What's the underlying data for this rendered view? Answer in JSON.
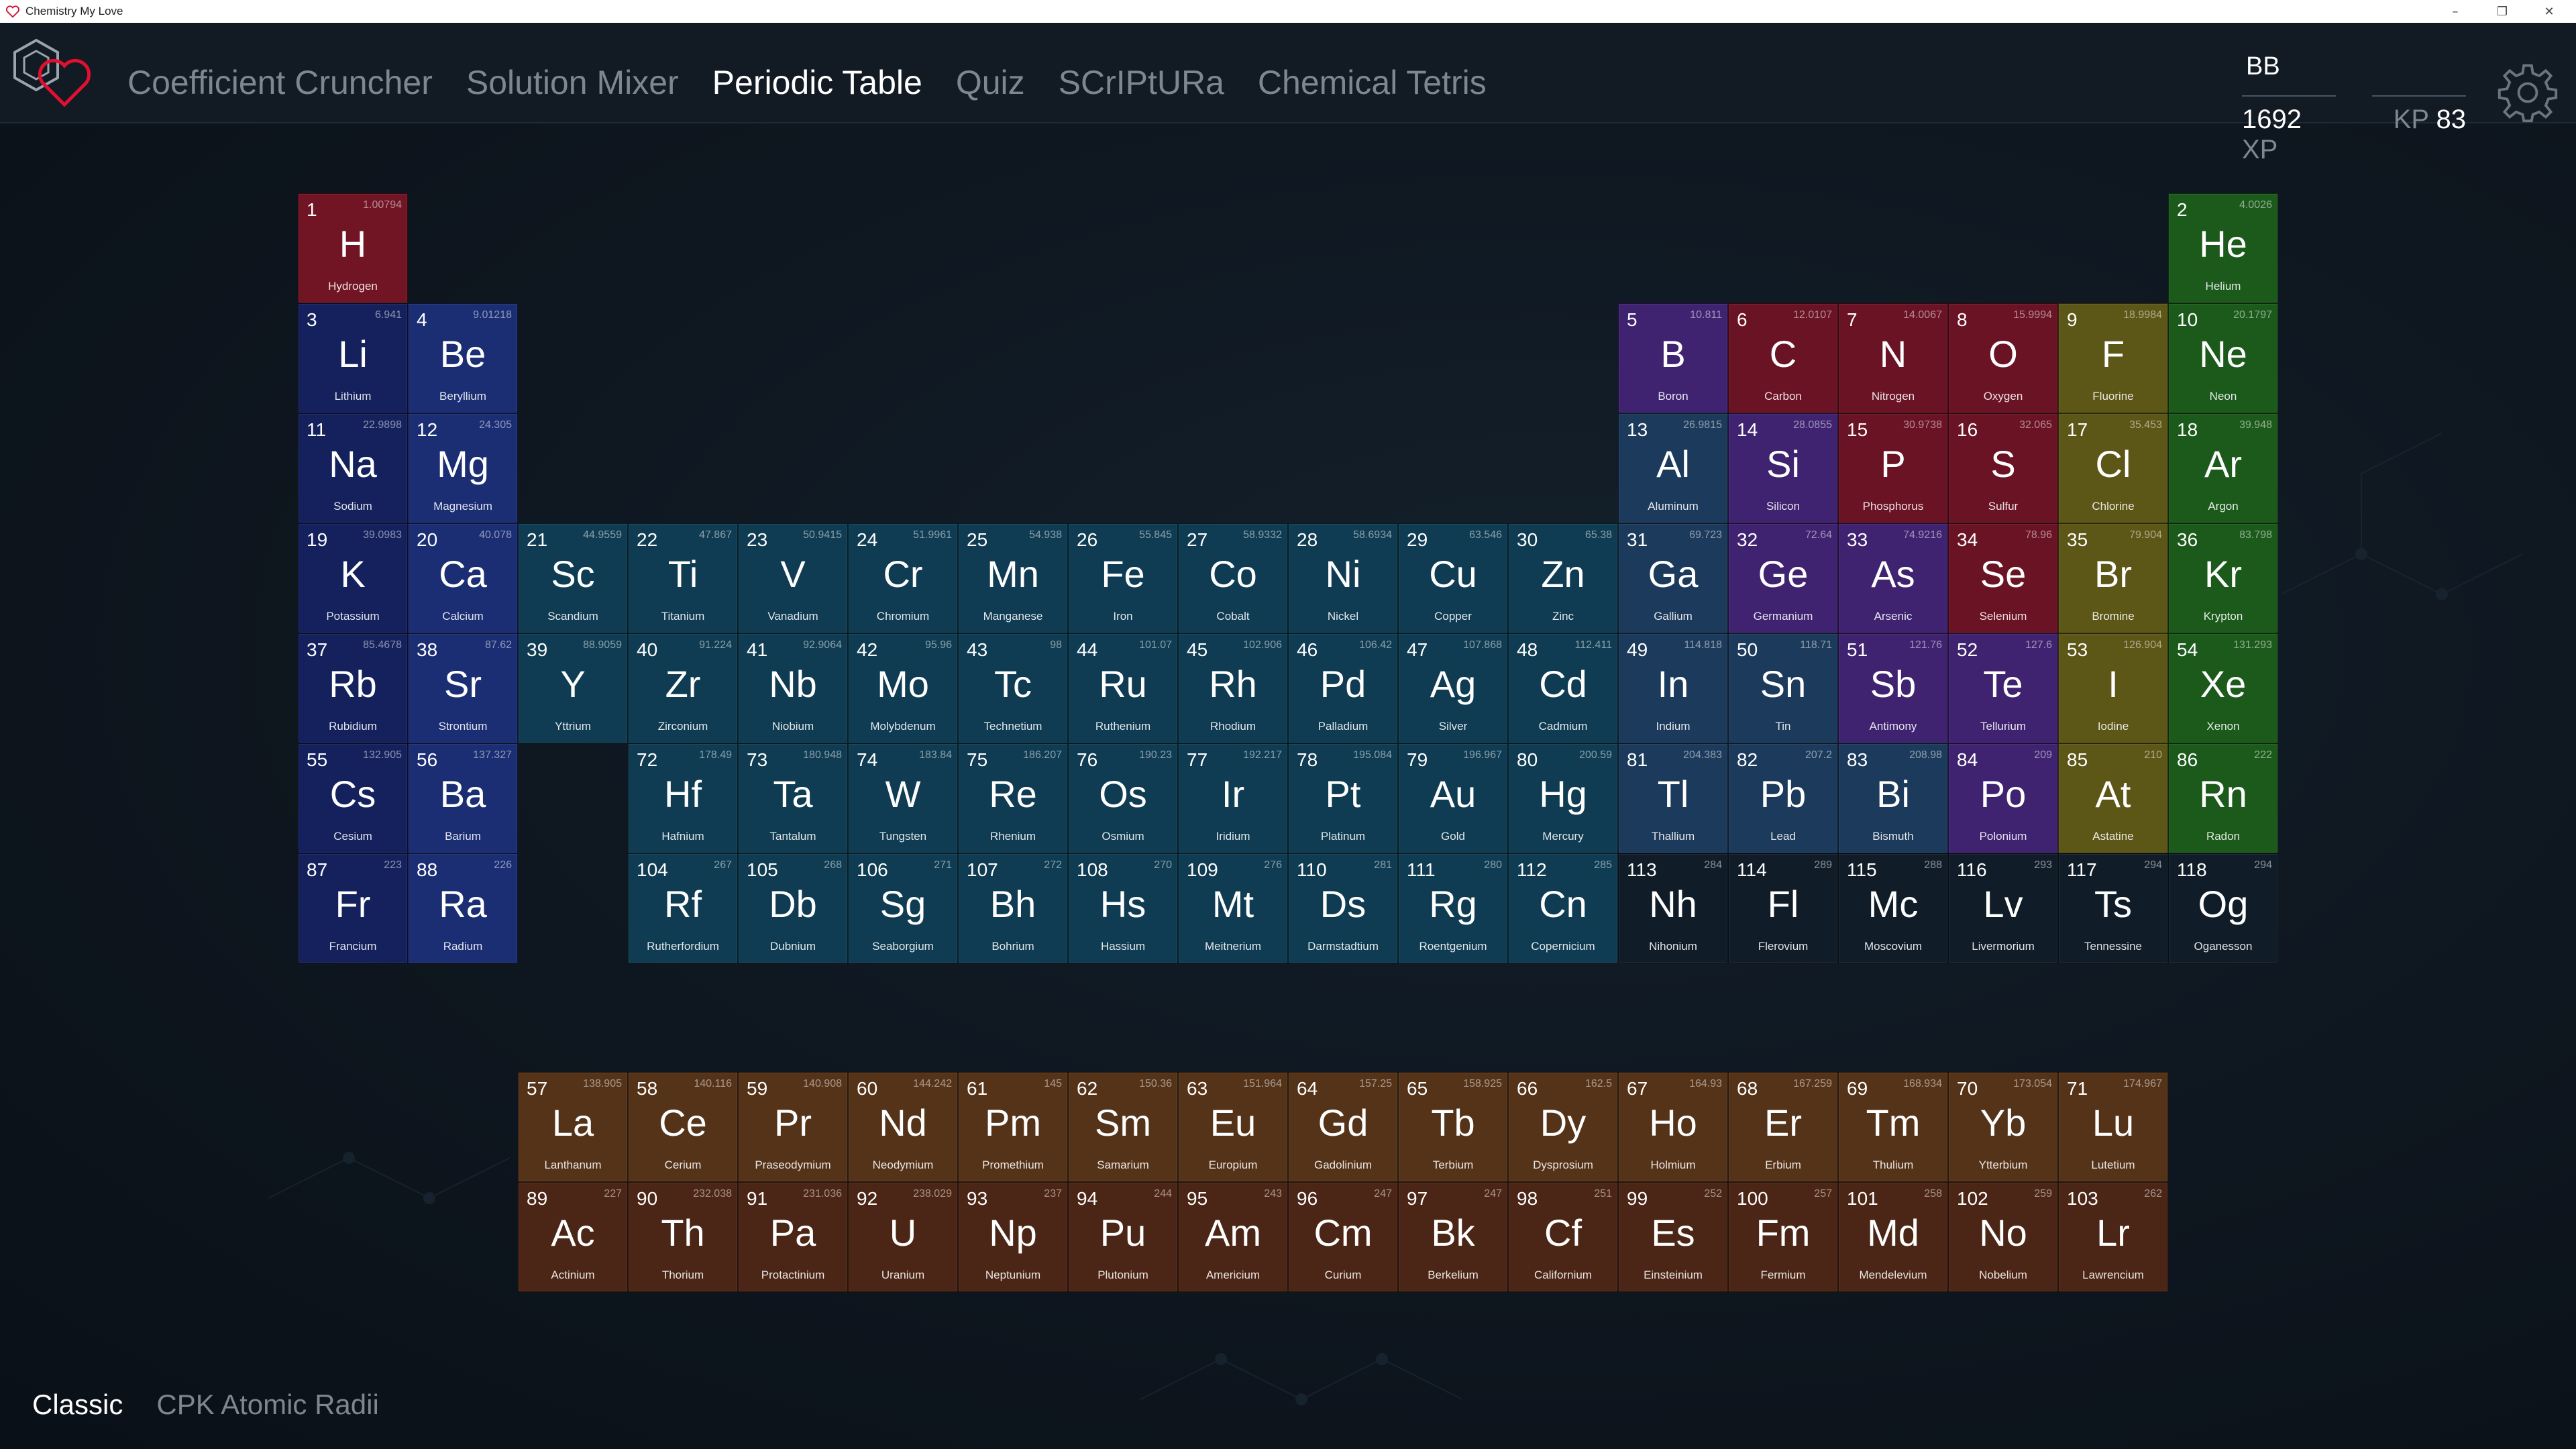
{
  "window": {
    "title": "Chemistry My Love",
    "minimize": "–",
    "maximize": "❐",
    "close": "✕"
  },
  "nav": [
    "Coefficient Cruncher",
    "Solution Mixer",
    "Periodic Table",
    "Quiz",
    "SCrIPtURa",
    "Chemical Tetris"
  ],
  "nav_active": "Periodic Table",
  "user": {
    "name": "BB",
    "xp_value": "1692",
    "xp_label": "XP",
    "kp_label": "KP",
    "kp_value": "83"
  },
  "modes": [
    "Classic",
    "CPK Atomic Radii"
  ],
  "mode_active": "Classic",
  "icons": {
    "settings": "gear-icon",
    "logo": "heart-hexagon-logo"
  },
  "colors": {
    "nonmetal": "#711524",
    "alkali": "#14215c",
    "alkaline": "#1b2e73",
    "transition": "#0f3c52",
    "posttransition": "#1c3a5b",
    "metalloid": "#3f2370",
    "reactive": "#6a1324",
    "halogen": "#5c5617",
    "noble": "#1c5a1c",
    "unknown": "#101d29",
    "lanthanide": "#543319",
    "actinide": "#4b2515"
  },
  "elements": [
    [
      "1",
      "H",
      "Hydrogen",
      "1.00794",
      1,
      1,
      "nonmetal"
    ],
    [
      "2",
      "He",
      "Helium",
      "4.0026",
      18,
      1,
      "noble"
    ],
    [
      "3",
      "Li",
      "Lithium",
      "6.941",
      1,
      2,
      "alkali"
    ],
    [
      "4",
      "Be",
      "Beryllium",
      "9.01218",
      2,
      2,
      "alkaline"
    ],
    [
      "5",
      "B",
      "Boron",
      "10.811",
      13,
      2,
      "metalloid"
    ],
    [
      "6",
      "C",
      "Carbon",
      "12.0107",
      14,
      2,
      "reactive"
    ],
    [
      "7",
      "N",
      "Nitrogen",
      "14.0067",
      15,
      2,
      "reactive"
    ],
    [
      "8",
      "O",
      "Oxygen",
      "15.9994",
      16,
      2,
      "reactive"
    ],
    [
      "9",
      "F",
      "Fluorine",
      "18.9984",
      17,
      2,
      "halogen"
    ],
    [
      "10",
      "Ne",
      "Neon",
      "20.1797",
      18,
      2,
      "noble"
    ],
    [
      "11",
      "Na",
      "Sodium",
      "22.9898",
      1,
      3,
      "alkali"
    ],
    [
      "12",
      "Mg",
      "Magnesium",
      "24.305",
      2,
      3,
      "alkaline"
    ],
    [
      "13",
      "Al",
      "Aluminum",
      "26.9815",
      13,
      3,
      "posttransition"
    ],
    [
      "14",
      "Si",
      "Silicon",
      "28.0855",
      14,
      3,
      "metalloid"
    ],
    [
      "15",
      "P",
      "Phosphorus",
      "30.9738",
      15,
      3,
      "reactive"
    ],
    [
      "16",
      "S",
      "Sulfur",
      "32.065",
      16,
      3,
      "reactive"
    ],
    [
      "17",
      "Cl",
      "Chlorine",
      "35.453",
      17,
      3,
      "halogen"
    ],
    [
      "18",
      "Ar",
      "Argon",
      "39.948",
      18,
      3,
      "noble"
    ],
    [
      "19",
      "K",
      "Potassium",
      "39.0983",
      1,
      4,
      "alkali"
    ],
    [
      "20",
      "Ca",
      "Calcium",
      "40.078",
      2,
      4,
      "alkaline"
    ],
    [
      "21",
      "Sc",
      "Scandium",
      "44.9559",
      3,
      4,
      "transition"
    ],
    [
      "22",
      "Ti",
      "Titanium",
      "47.867",
      4,
      4,
      "transition"
    ],
    [
      "23",
      "V",
      "Vanadium",
      "50.9415",
      5,
      4,
      "transition"
    ],
    [
      "24",
      "Cr",
      "Chromium",
      "51.9961",
      6,
      4,
      "transition"
    ],
    [
      "25",
      "Mn",
      "Manganese",
      "54.938",
      7,
      4,
      "transition"
    ],
    [
      "26",
      "Fe",
      "Iron",
      "55.845",
      8,
      4,
      "transition"
    ],
    [
      "27",
      "Co",
      "Cobalt",
      "58.9332",
      9,
      4,
      "transition"
    ],
    [
      "28",
      "Ni",
      "Nickel",
      "58.6934",
      10,
      4,
      "transition"
    ],
    [
      "29",
      "Cu",
      "Copper",
      "63.546",
      11,
      4,
      "transition"
    ],
    [
      "30",
      "Zn",
      "Zinc",
      "65.38",
      12,
      4,
      "transition"
    ],
    [
      "31",
      "Ga",
      "Gallium",
      "69.723",
      13,
      4,
      "posttransition"
    ],
    [
      "32",
      "Ge",
      "Germanium",
      "72.64",
      14,
      4,
      "metalloid"
    ],
    [
      "33",
      "As",
      "Arsenic",
      "74.9216",
      15,
      4,
      "metalloid"
    ],
    [
      "34",
      "Se",
      "Selenium",
      "78.96",
      16,
      4,
      "reactive"
    ],
    [
      "35",
      "Br",
      "Bromine",
      "79.904",
      17,
      4,
      "halogen"
    ],
    [
      "36",
      "Kr",
      "Krypton",
      "83.798",
      18,
      4,
      "noble"
    ],
    [
      "37",
      "Rb",
      "Rubidium",
      "85.4678",
      1,
      5,
      "alkali"
    ],
    [
      "38",
      "Sr",
      "Strontium",
      "87.62",
      2,
      5,
      "alkaline"
    ],
    [
      "39",
      "Y",
      "Yttrium",
      "88.9059",
      3,
      5,
      "transition"
    ],
    [
      "40",
      "Zr",
      "Zirconium",
      "91.224",
      4,
      5,
      "transition"
    ],
    [
      "41",
      "Nb",
      "Niobium",
      "92.9064",
      5,
      5,
      "transition"
    ],
    [
      "42",
      "Mo",
      "Molybdenum",
      "95.96",
      6,
      5,
      "transition"
    ],
    [
      "43",
      "Tc",
      "Technetium",
      "98",
      7,
      5,
      "transition"
    ],
    [
      "44",
      "Ru",
      "Ruthenium",
      "101.07",
      8,
      5,
      "transition"
    ],
    [
      "45",
      "Rh",
      "Rhodium",
      "102.906",
      9,
      5,
      "transition"
    ],
    [
      "46",
      "Pd",
      "Palladium",
      "106.42",
      10,
      5,
      "transition"
    ],
    [
      "47",
      "Ag",
      "Silver",
      "107.868",
      11,
      5,
      "transition"
    ],
    [
      "48",
      "Cd",
      "Cadmium",
      "112.411",
      12,
      5,
      "transition"
    ],
    [
      "49",
      "In",
      "Indium",
      "114.818",
      13,
      5,
      "posttransition"
    ],
    [
      "50",
      "Sn",
      "Tin",
      "118.71",
      14,
      5,
      "posttransition"
    ],
    [
      "51",
      "Sb",
      "Antimony",
      "121.76",
      15,
      5,
      "metalloid"
    ],
    [
      "52",
      "Te",
      "Tellurium",
      "127.6",
      16,
      5,
      "metalloid"
    ],
    [
      "53",
      "I",
      "Iodine",
      "126.904",
      17,
      5,
      "halogen"
    ],
    [
      "54",
      "Xe",
      "Xenon",
      "131.293",
      18,
      5,
      "noble"
    ],
    [
      "55",
      "Cs",
      "Cesium",
      "132.905",
      1,
      6,
      "alkali"
    ],
    [
      "56",
      "Ba",
      "Barium",
      "137.327",
      2,
      6,
      "alkaline"
    ],
    [
      "72",
      "Hf",
      "Hafnium",
      "178.49",
      4,
      6,
      "transition"
    ],
    [
      "73",
      "Ta",
      "Tantalum",
      "180.948",
      5,
      6,
      "transition"
    ],
    [
      "74",
      "W",
      "Tungsten",
      "183.84",
      6,
      6,
      "transition"
    ],
    [
      "75",
      "Re",
      "Rhenium",
      "186.207",
      7,
      6,
      "transition"
    ],
    [
      "76",
      "Os",
      "Osmium",
      "190.23",
      8,
      6,
      "transition"
    ],
    [
      "77",
      "Ir",
      "Iridium",
      "192.217",
      9,
      6,
      "transition"
    ],
    [
      "78",
      "Pt",
      "Platinum",
      "195.084",
      10,
      6,
      "transition"
    ],
    [
      "79",
      "Au",
      "Gold",
      "196.967",
      11,
      6,
      "transition"
    ],
    [
      "80",
      "Hg",
      "Mercury",
      "200.59",
      12,
      6,
      "transition"
    ],
    [
      "81",
      "Tl",
      "Thallium",
      "204.383",
      13,
      6,
      "posttransition"
    ],
    [
      "82",
      "Pb",
      "Lead",
      "207.2",
      14,
      6,
      "posttransition"
    ],
    [
      "83",
      "Bi",
      "Bismuth",
      "208.98",
      15,
      6,
      "posttransition"
    ],
    [
      "84",
      "Po",
      "Polonium",
      "209",
      16,
      6,
      "metalloid"
    ],
    [
      "85",
      "At",
      "Astatine",
      "210",
      17,
      6,
      "halogen"
    ],
    [
      "86",
      "Rn",
      "Radon",
      "222",
      18,
      6,
      "noble"
    ],
    [
      "87",
      "Fr",
      "Francium",
      "223",
      1,
      7,
      "alkali"
    ],
    [
      "88",
      "Ra",
      "Radium",
      "226",
      2,
      7,
      "alkaline"
    ],
    [
      "104",
      "Rf",
      "Rutherfordium",
      "267",
      4,
      7,
      "transition"
    ],
    [
      "105",
      "Db",
      "Dubnium",
      "268",
      5,
      7,
      "transition"
    ],
    [
      "106",
      "Sg",
      "Seaborgium",
      "271",
      6,
      7,
      "transition"
    ],
    [
      "107",
      "Bh",
      "Bohrium",
      "272",
      7,
      7,
      "transition"
    ],
    [
      "108",
      "Hs",
      "Hassium",
      "270",
      8,
      7,
      "transition"
    ],
    [
      "109",
      "Mt",
      "Meitnerium",
      "276",
      9,
      7,
      "transition"
    ],
    [
      "110",
      "Ds",
      "Darmstadtium",
      "281",
      10,
      7,
      "transition"
    ],
    [
      "111",
      "Rg",
      "Roentgenium",
      "280",
      11,
      7,
      "transition"
    ],
    [
      "112",
      "Cn",
      "Copernicium",
      "285",
      12,
      7,
      "transition"
    ],
    [
      "113",
      "Nh",
      "Nihonium",
      "284",
      13,
      7,
      "unknown"
    ],
    [
      "114",
      "Fl",
      "Flerovium",
      "289",
      14,
      7,
      "unknown"
    ],
    [
      "115",
      "Mc",
      "Moscovium",
      "288",
      15,
      7,
      "unknown"
    ],
    [
      "116",
      "Lv",
      "Livermorium",
      "293",
      16,
      7,
      "unknown"
    ],
    [
      "117",
      "Ts",
      "Tennessine",
      "294",
      17,
      7,
      "unknown"
    ],
    [
      "118",
      "Og",
      "Oganesson",
      "294",
      18,
      7,
      "unknown"
    ],
    [
      "57",
      "La",
      "Lanthanum",
      "138.905",
      3,
      9,
      "lanthanide"
    ],
    [
      "58",
      "Ce",
      "Cerium",
      "140.116",
      4,
      9,
      "lanthanide"
    ],
    [
      "59",
      "Pr",
      "Praseodymium",
      "140.908",
      5,
      9,
      "lanthanide"
    ],
    [
      "60",
      "Nd",
      "Neodymium",
      "144.242",
      6,
      9,
      "lanthanide"
    ],
    [
      "61",
      "Pm",
      "Promethium",
      "145",
      7,
      9,
      "lanthanide"
    ],
    [
      "62",
      "Sm",
      "Samarium",
      "150.36",
      8,
      9,
      "lanthanide"
    ],
    [
      "63",
      "Eu",
      "Europium",
      "151.964",
      9,
      9,
      "lanthanide"
    ],
    [
      "64",
      "Gd",
      "Gadolinium",
      "157.25",
      10,
      9,
      "lanthanide"
    ],
    [
      "65",
      "Tb",
      "Terbium",
      "158.925",
      11,
      9,
      "lanthanide"
    ],
    [
      "66",
      "Dy",
      "Dysprosium",
      "162.5",
      12,
      9,
      "lanthanide"
    ],
    [
      "67",
      "Ho",
      "Holmium",
      "164.93",
      13,
      9,
      "lanthanide"
    ],
    [
      "68",
      "Er",
      "Erbium",
      "167.259",
      14,
      9,
      "lanthanide"
    ],
    [
      "69",
      "Tm",
      "Thulium",
      "168.934",
      15,
      9,
      "lanthanide"
    ],
    [
      "70",
      "Yb",
      "Ytterbium",
      "173.054",
      16,
      9,
      "lanthanide"
    ],
    [
      "71",
      "Lu",
      "Lutetium",
      "174.967",
      17,
      9,
      "lanthanide"
    ],
    [
      "89",
      "Ac",
      "Actinium",
      "227",
      3,
      10,
      "actinide"
    ],
    [
      "90",
      "Th",
      "Thorium",
      "232.038",
      4,
      10,
      "actinide"
    ],
    [
      "91",
      "Pa",
      "Protactinium",
      "231.036",
      5,
      10,
      "actinide"
    ],
    [
      "92",
      "U",
      "Uranium",
      "238.029",
      6,
      10,
      "actinide"
    ],
    [
      "93",
      "Np",
      "Neptunium",
      "237",
      7,
      10,
      "actinide"
    ],
    [
      "94",
      "Pu",
      "Plutonium",
      "244",
      8,
      10,
      "actinide"
    ],
    [
      "95",
      "Am",
      "Americium",
      "243",
      9,
      10,
      "actinide"
    ],
    [
      "96",
      "Cm",
      "Curium",
      "247",
      10,
      10,
      "actinide"
    ],
    [
      "97",
      "Bk",
      "Berkelium",
      "247",
      11,
      10,
      "actinide"
    ],
    [
      "98",
      "Cf",
      "Californium",
      "251",
      12,
      10,
      "actinide"
    ],
    [
      "99",
      "Es",
      "Einsteinium",
      "252",
      13,
      10,
      "actinide"
    ],
    [
      "100",
      "Fm",
      "Fermium",
      "257",
      14,
      10,
      "actinide"
    ],
    [
      "101",
      "Md",
      "Mendelevium",
      "258",
      15,
      10,
      "actinide"
    ],
    [
      "102",
      "No",
      "Nobelium",
      "259",
      16,
      10,
      "actinide"
    ],
    [
      "103",
      "Lr",
      "Lawrencium",
      "262",
      17,
      10,
      "actinide"
    ]
  ]
}
